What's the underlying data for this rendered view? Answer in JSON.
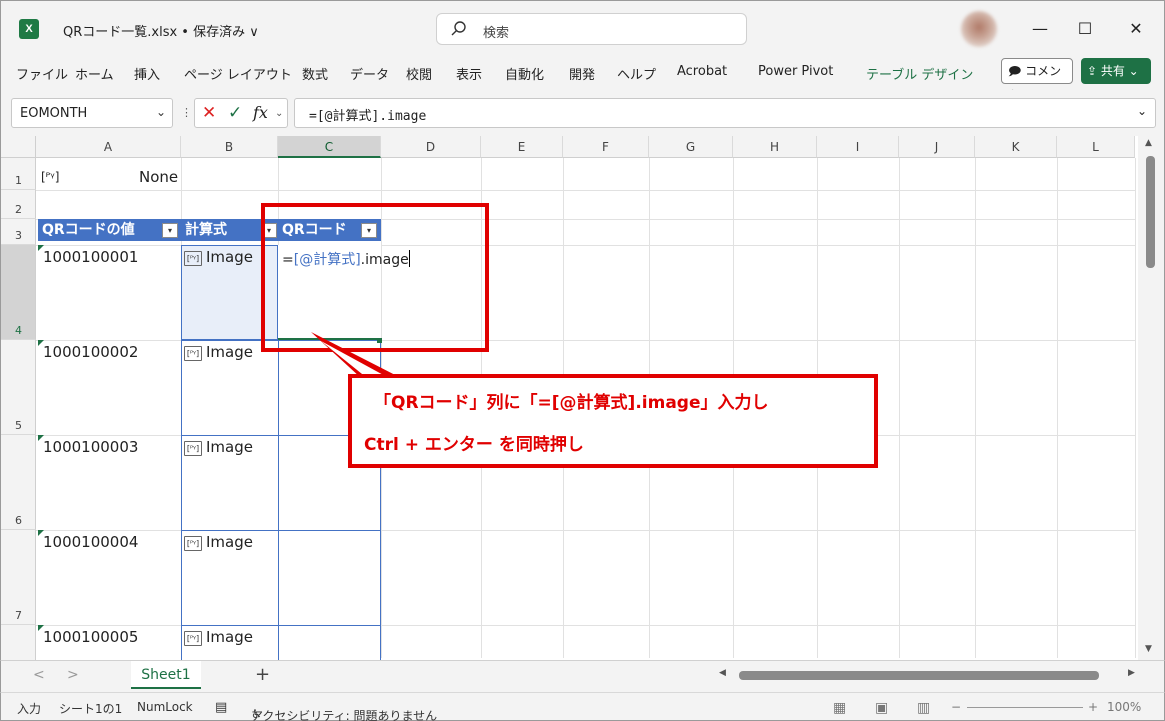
{
  "app": {
    "logo_letter": "X",
    "doc_title": "QRコード一覧.xlsx • 保存済み ∨",
    "search_placeholder": "検索",
    "minimize": "—",
    "maximize": "☐",
    "close": "✕"
  },
  "ribbon": {
    "tabs": [
      "ファイル",
      "ホーム",
      "挿入",
      "ページ レイアウト",
      "数式",
      "データ",
      "校閲",
      "表示",
      "自動化",
      "開発",
      "ヘルプ",
      "Acrobat",
      "Power Pivot",
      "テーブル デザイン"
    ],
    "comment_label": "🗩 コメント",
    "share_label": "⇪ 共有 ⌄"
  },
  "formula_bar": {
    "name_box": "EOMONTH",
    "cancel": "✕",
    "enter": "✓",
    "fx": "fx",
    "formula": "=[@計算式].image"
  },
  "grid": {
    "columns": [
      "A",
      "B",
      "C",
      "D",
      "E",
      "F",
      "G",
      "H",
      "I",
      "J",
      "K",
      "L"
    ],
    "selected_column": "C",
    "rows": [
      "1",
      "2",
      "3",
      "4",
      "5",
      "6",
      "7"
    ],
    "selected_row": "4",
    "a1_icon": "[ᴾᵞ]",
    "b1_value": "None",
    "table_headers": [
      "QRコードの値",
      "計算式",
      "QRコード"
    ],
    "filter_arrow": "▾",
    "values_a": [
      "1000100001",
      "1000100002",
      "1000100003",
      "1000100004",
      "1000100005"
    ],
    "values_b": [
      "Image",
      "Image",
      "Image",
      "Image",
      "Image"
    ],
    "edit_prefix": "=",
    "edit_ref": "[@計算式]",
    "edit_suffix": ".image"
  },
  "callout": {
    "line1": "「QRコード」列に「=[@計算式].image」入力し",
    "line2": "Ctrl + エンター を同時押し"
  },
  "sheets": {
    "prev": "<",
    "next": ">",
    "active": "Sheet1",
    "add": "+"
  },
  "status": {
    "mode": "入力",
    "sheet_pos": "シート1の1",
    "numlock": "NumLock",
    "accessibility": "アクセシビリティ: 問題ありません",
    "zoom": "100%"
  },
  "colors": {
    "excel_green": "#1e7145",
    "table_blue": "#4472c4",
    "callout_red": "#e00000"
  }
}
